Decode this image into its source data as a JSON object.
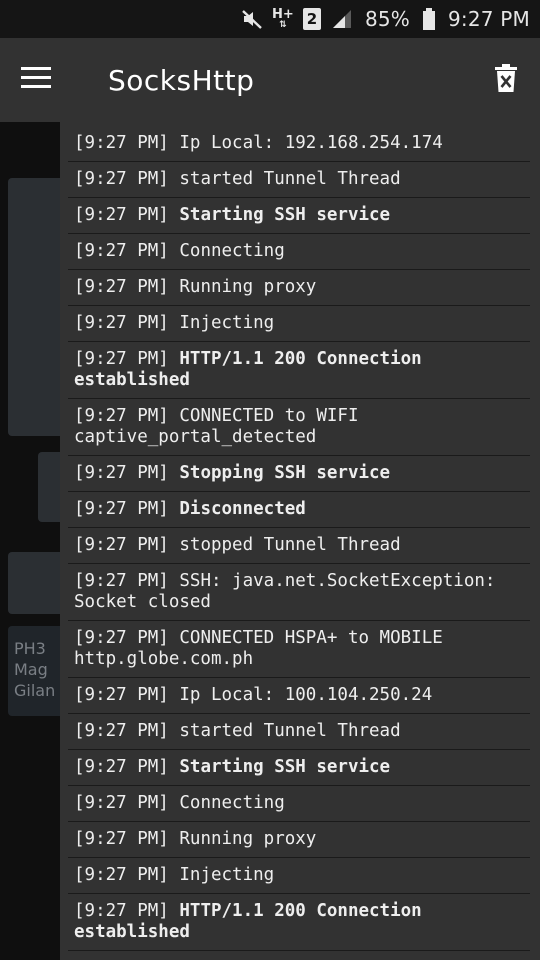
{
  "status_bar": {
    "battery": "85%",
    "time": "9:27 PM",
    "icons": [
      "mute-icon",
      "hplus-network-icon",
      "sim-2-icon",
      "signal-icon",
      "battery-icon"
    ],
    "network": "H+",
    "sim": "2"
  },
  "app_bar": {
    "title": "SocksHttp",
    "menu_icon": "hamburger-menu-icon",
    "action_icon": "delete-icon"
  },
  "background": {
    "note_lines": [
      "PH3",
      "Mag",
      "Gilan"
    ]
  },
  "log": {
    "entries": [
      {
        "time": "[9:27 PM]",
        "message": "Ip Local: 192.168.254.174",
        "bold": false
      },
      {
        "time": "[9:27 PM]",
        "message": "started Tunnel Thread",
        "bold": false
      },
      {
        "time": "[9:27 PM]",
        "message": "Starting SSH service",
        "bold": true
      },
      {
        "time": "[9:27 PM]",
        "message": "Connecting",
        "bold": false
      },
      {
        "time": "[9:27 PM]",
        "message": "Running proxy",
        "bold": false
      },
      {
        "time": "[9:27 PM]",
        "message": "Injecting",
        "bold": false
      },
      {
        "time": "[9:27 PM]",
        "message": "HTTP/1.1 200 Connection established",
        "bold": true
      },
      {
        "time": "[9:27 PM]",
        "message": "CONNECTED to WIFI captive_portal_detected",
        "bold": false
      },
      {
        "time": "[9:27 PM]",
        "message": "Stopping SSH service",
        "bold": true
      },
      {
        "time": "[9:27 PM]",
        "message": "Disconnected",
        "bold": true
      },
      {
        "time": "[9:27 PM]",
        "message": "stopped Tunnel Thread",
        "bold": false
      },
      {
        "time": "[9:27 PM]",
        "message": "SSH: java.net.SocketException: Socket closed",
        "bold": false
      },
      {
        "time": "[9:27 PM]",
        "message": "CONNECTED HSPA+ to MOBILE http.globe.com.ph",
        "bold": false
      },
      {
        "time": "[9:27 PM]",
        "message": "Ip Local: 100.104.250.24",
        "bold": false
      },
      {
        "time": "[9:27 PM]",
        "message": "started Tunnel Thread",
        "bold": false
      },
      {
        "time": "[9:27 PM]",
        "message": "Starting SSH service",
        "bold": true
      },
      {
        "time": "[9:27 PM]",
        "message": "Connecting",
        "bold": false
      },
      {
        "time": "[9:27 PM]",
        "message": "Running proxy",
        "bold": false
      },
      {
        "time": "[9:27 PM]",
        "message": "Injecting",
        "bold": false
      },
      {
        "time": "[9:27 PM]",
        "message": "HTTP/1.1 200 Connection established",
        "bold": true
      }
    ]
  }
}
